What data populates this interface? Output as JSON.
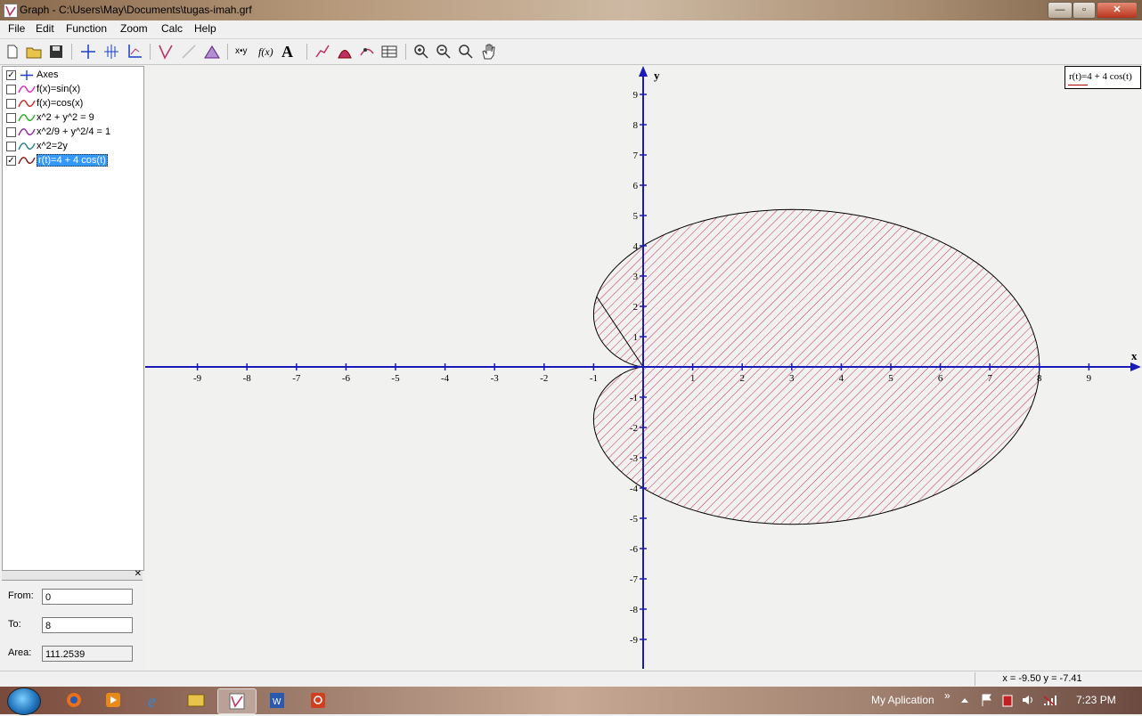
{
  "window": {
    "title": "Graph - C:\\Users\\May\\Documents\\tugas-imah.grf",
    "minimize": "—",
    "maximize": "▫",
    "close": "✕"
  },
  "menu": [
    "File",
    "Edit",
    "Function",
    "Zoom",
    "Calc",
    "Help"
  ],
  "functions": [
    {
      "label": "Axes",
      "checked": true,
      "color": "#1a3fc4",
      "icon": "axes-icon"
    },
    {
      "label": "f(x)=sin(x)",
      "checked": false,
      "color": "#e020c0",
      "icon": "curve-icon"
    },
    {
      "label": "f(x)=cos(x)",
      "checked": false,
      "color": "#d02020",
      "icon": "curve-icon"
    },
    {
      "label": "x^2 + y^2 = 9",
      "checked": false,
      "color": "#20b020",
      "icon": "curve-icon"
    },
    {
      "label": "x^2/9 + y^2/4 = 1",
      "checked": false,
      "color": "#9020a0",
      "icon": "curve-icon"
    },
    {
      "label": "x^2=2y",
      "checked": false,
      "color": "#208080",
      "icon": "curve-icon"
    },
    {
      "label": "r(t)=4 + 4 cos(t)",
      "checked": true,
      "color": "#8a1010",
      "icon": "curve-icon",
      "selected": true
    }
  ],
  "area_panel": {
    "close": "✕",
    "from_label": "From:",
    "from_value": "0",
    "to_label": "To:",
    "to_value": "8",
    "area_label": "Area:",
    "area_value": "111.2539"
  },
  "legend": {
    "text": "r(t)=4 + 4 cos(t)"
  },
  "status": {
    "coords": "x = -9.50   y = -7.41"
  },
  "taskbar": {
    "toolbar_label": "My Aplication",
    "chevron": "»",
    "time": "7:23 PM"
  },
  "chart_data": {
    "type": "line",
    "title": "",
    "xlabel": "x",
    "ylabel": "y",
    "xlim": [
      -10,
      10
    ],
    "ylim": [
      -10,
      10
    ],
    "x_ticks": [
      -9,
      -8,
      -7,
      -6,
      -5,
      -4,
      -3,
      -2,
      -1,
      1,
      2,
      3,
      4,
      5,
      6,
      7,
      8,
      9
    ],
    "y_ticks": [
      -9,
      -8,
      -7,
      -6,
      -5,
      -4,
      -3,
      -2,
      -1,
      1,
      2,
      3,
      4,
      5,
      6,
      7,
      8,
      9
    ],
    "series": [
      {
        "name": "r(t)=4 + 4 cos(t)",
        "polar": "r = 4 + 4 cos(t)",
        "color": "#000000",
        "shaded_area": {
          "from": 0,
          "to": 8,
          "area": 111.2539,
          "hatch_color": "#c0306a"
        }
      }
    ],
    "grid": false,
    "legend_position": "top-right"
  }
}
